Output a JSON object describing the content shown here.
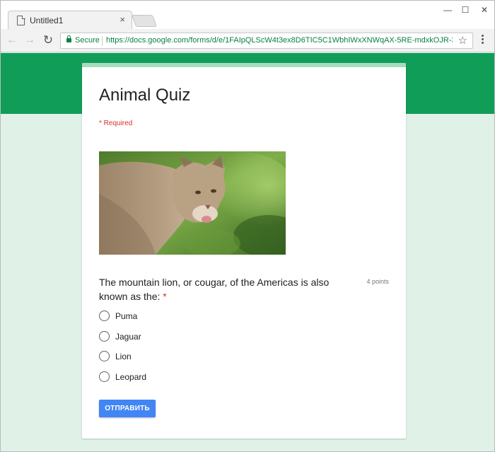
{
  "browser": {
    "tab_title": "Untitled1",
    "tab_close": "×",
    "window_controls": {
      "minimize": "—",
      "maximize": "☐",
      "close": "✕"
    },
    "nav": {
      "back": "←",
      "forward": "→",
      "reload": "↻"
    },
    "secure_label": "Secure",
    "url": "https://docs.google.com/forms/d/e/1FAIpQLScW4t3ex8D6TIC5C1WbhIWxXNWqAX-5RE-mdxkOJR-3ieJt...",
    "bookmark_star": "☆"
  },
  "form": {
    "title": "Animal Quiz",
    "required_note": "* Required",
    "image_icon": "cougar-photo",
    "question": {
      "text": "The mountain lion, or cougar, of the Americas is also known as the:",
      "required_star": "*",
      "points": "4 points",
      "options": [
        {
          "label": "Puma"
        },
        {
          "label": "Jaguar"
        },
        {
          "label": "Lion"
        },
        {
          "label": "Leopard"
        }
      ]
    },
    "submit_label": "ОТПРАВИТЬ"
  },
  "colors": {
    "header_green": "#109d58",
    "page_background": "#e0f2e8",
    "card_accent": "#a6dcbc",
    "required_red": "#d93025",
    "submit_blue": "#4285f4",
    "secure_green": "#0b8043"
  }
}
